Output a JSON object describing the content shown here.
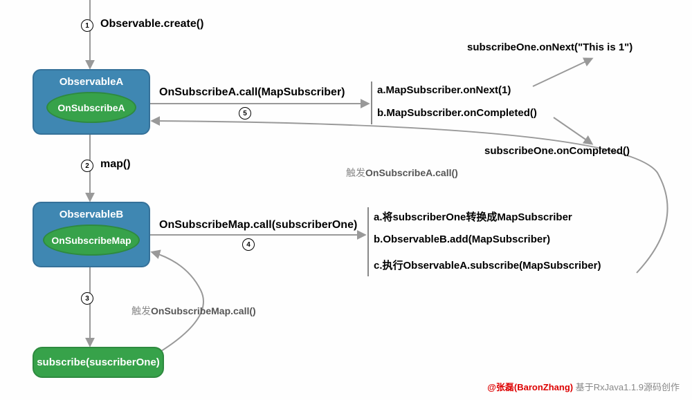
{
  "steps": {
    "s1": "1",
    "s2": "2",
    "s3": "3",
    "s4": "4",
    "s5": "5"
  },
  "labels": {
    "create": "Observable.create()",
    "map": "map()",
    "callA": "OnSubscribeA.call(MapSubscriber)",
    "callMap": "OnSubscribeMap.call(subscriberOne)",
    "triggerA_prefix": "触发",
    "triggerA_main": "OnSubscribeA.call()",
    "triggerMap_prefix": "触发",
    "triggerMap_main": "OnSubscribeMap.call()"
  },
  "boxes": {
    "obsA_title": "ObservableA",
    "onSubA": "OnSubscribeA",
    "obsB_title": "ObservableB",
    "onSubMap": "OnSubscribeMap",
    "subscribe": "subscribe(suscriberOne)"
  },
  "results_top": {
    "a": "a.MapSubscriber.onNext(1)",
    "b": "b.MapSubscriber.onCompleted()",
    "onNextStr": "subscribeOne.onNext(\"This is 1\")",
    "onCompleted": "subscribeOne.onCompleted()"
  },
  "results_bottom": {
    "a": "a.将subscriberOne转换成MapSubscriber",
    "b": "b.ObservableB.add(MapSubscriber)",
    "c": "c.执行ObservableA.subscribe(MapSubscriber)"
  },
  "credit": {
    "author": "@张磊(BaronZhang)",
    "note": " 基于RxJava1.1.9源码创作"
  }
}
